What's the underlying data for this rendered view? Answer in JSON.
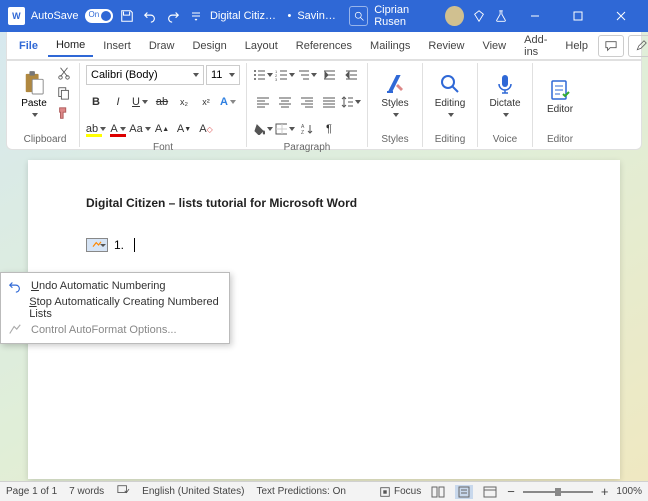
{
  "titlebar": {
    "autosave_label": "AutoSave",
    "autosave_state": "On",
    "document_title": "Digital Citizen...",
    "saving_status": "Saving...",
    "user_name": "Ciprian Rusen"
  },
  "menu": {
    "file": "File",
    "home": "Home",
    "insert": "Insert",
    "draw": "Draw",
    "design": "Design",
    "layout": "Layout",
    "references": "References",
    "mailings": "Mailings",
    "review": "Review",
    "view": "View",
    "addins": "Add-ins",
    "help": "Help",
    "editing_mode": "Editing"
  },
  "ribbon": {
    "clipboard": {
      "label": "Clipboard",
      "paste": "Paste"
    },
    "font": {
      "label": "Font",
      "family": "Calibri (Body)",
      "size": "11"
    },
    "paragraph": {
      "label": "Paragraph"
    },
    "styles": {
      "label": "Styles",
      "btn": "Styles"
    },
    "editing": {
      "label": "Editing",
      "btn": "Editing"
    },
    "voice": {
      "label": "Voice",
      "btn": "Dictate"
    },
    "editor": {
      "label": "Editor",
      "btn": "Editor"
    }
  },
  "document": {
    "heading": "Digital Citizen – lists tutorial for Microsoft Word",
    "list_number": "1."
  },
  "context_menu": {
    "undo": "ndo Automatic Numbering",
    "undo_accel": "U",
    "stop": "top Automatically Creating Numbered Lists",
    "stop_accel": "S",
    "control": "Control AutoFormat Options..."
  },
  "statusbar": {
    "page": "Page 1 of 1",
    "words": "7 words",
    "language": "English (United States)",
    "predictions": "Text Predictions: On",
    "focus": "Focus",
    "zoom": "100%"
  }
}
